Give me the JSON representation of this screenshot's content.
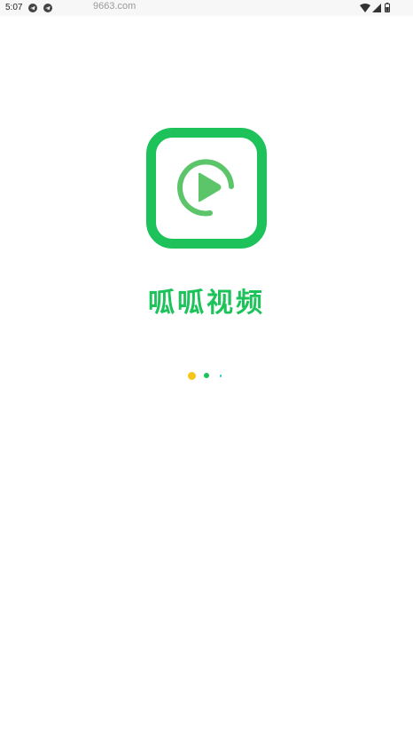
{
  "status_bar": {
    "time": "5:07",
    "left_icons": [
      "telegram-icon",
      "telegram-icon"
    ],
    "right_icons": [
      "wifi-icon",
      "cellular-signal-icon",
      "battery-icon"
    ]
  },
  "watermark": {
    "text": "9663.com"
  },
  "splash": {
    "logo_icon": "play-circle-icon",
    "app_name": "呱呱视频",
    "loading_indicator": "loading-dots",
    "colors": {
      "brand_green": "#1dc35a",
      "logo_inner_green": "#5cc56a",
      "dot_yellow": "#f5c518",
      "dot_green": "#1dc35a",
      "dot_cyan": "#1ec3e0"
    }
  }
}
